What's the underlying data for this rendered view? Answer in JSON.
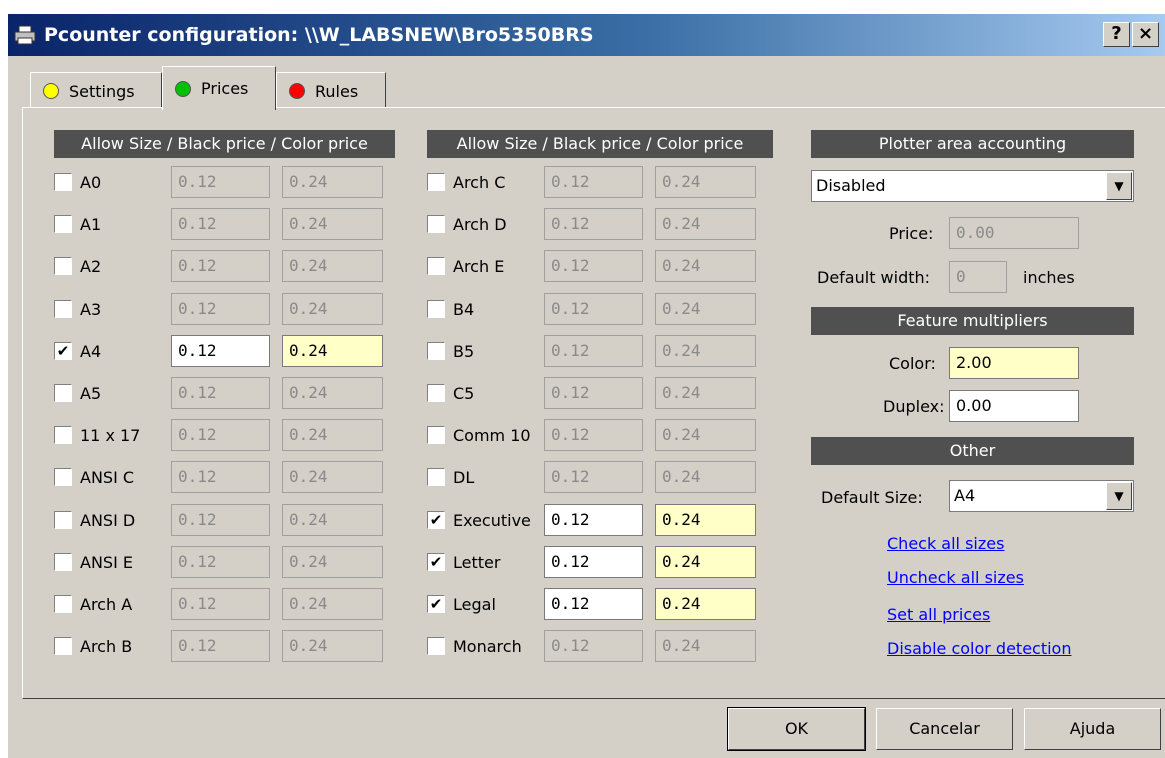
{
  "window": {
    "title": "Pcounter configuration: \\\\W_LABSNEW\\Bro5350BRS",
    "help_glyph": "?",
    "close_glyph": "×"
  },
  "tabs": [
    {
      "label": "Settings",
      "color": "#ffff00"
    },
    {
      "label": "Prices",
      "color": "#00c000"
    },
    {
      "label": "Rules",
      "color": "#ff0000"
    }
  ],
  "headers": {
    "col1": "Allow Size / Black price / Color price",
    "col2": "Allow Size / Black price / Color price",
    "plotter": "Plotter area accounting",
    "feature": "Feature multipliers",
    "other": "Other"
  },
  "sizes_left": [
    {
      "label": "A0",
      "checked": false,
      "black": "0.12",
      "color": "0.24"
    },
    {
      "label": "A1",
      "checked": false,
      "black": "0.12",
      "color": "0.24"
    },
    {
      "label": "A2",
      "checked": false,
      "black": "0.12",
      "color": "0.24"
    },
    {
      "label": "A3",
      "checked": false,
      "black": "0.12",
      "color": "0.24"
    },
    {
      "label": "A4",
      "checked": true,
      "black": "0.12",
      "color": "0.24"
    },
    {
      "label": "A5",
      "checked": false,
      "black": "0.12",
      "color": "0.24"
    },
    {
      "label": "11 x 17",
      "checked": false,
      "black": "0.12",
      "color": "0.24"
    },
    {
      "label": "ANSI C",
      "checked": false,
      "black": "0.12",
      "color": "0.24"
    },
    {
      "label": "ANSI D",
      "checked": false,
      "black": "0.12",
      "color": "0.24"
    },
    {
      "label": "ANSI E",
      "checked": false,
      "black": "0.12",
      "color": "0.24"
    },
    {
      "label": "Arch A",
      "checked": false,
      "black": "0.12",
      "color": "0.24"
    },
    {
      "label": "Arch B",
      "checked": false,
      "black": "0.12",
      "color": "0.24"
    }
  ],
  "sizes_right": [
    {
      "label": "Arch C",
      "checked": false,
      "black": "0.12",
      "color": "0.24"
    },
    {
      "label": "Arch D",
      "checked": false,
      "black": "0.12",
      "color": "0.24"
    },
    {
      "label": "Arch E",
      "checked": false,
      "black": "0.12",
      "color": "0.24"
    },
    {
      "label": "B4",
      "checked": false,
      "black": "0.12",
      "color": "0.24"
    },
    {
      "label": "B5",
      "checked": false,
      "black": "0.12",
      "color": "0.24"
    },
    {
      "label": "C5",
      "checked": false,
      "black": "0.12",
      "color": "0.24"
    },
    {
      "label": "Comm 10",
      "checked": false,
      "black": "0.12",
      "color": "0.24"
    },
    {
      "label": "DL",
      "checked": false,
      "black": "0.12",
      "color": "0.24"
    },
    {
      "label": "Executive",
      "checked": true,
      "black": "0.12",
      "color": "0.24"
    },
    {
      "label": "Letter",
      "checked": true,
      "black": "0.12",
      "color": "0.24"
    },
    {
      "label": "Legal",
      "checked": true,
      "black": "0.12",
      "color": "0.24"
    },
    {
      "label": "Monarch",
      "checked": false,
      "black": "0.12",
      "color": "0.24"
    }
  ],
  "plotter": {
    "mode": "Disabled",
    "price_label": "Price:",
    "price": "0.00",
    "width_label": "Default width:",
    "width": "0",
    "width_unit": "inches"
  },
  "feature": {
    "color_label": "Color:",
    "color": "2.00",
    "duplex_label": "Duplex:",
    "duplex": "0.00"
  },
  "other": {
    "default_size_label": "Default Size:",
    "default_size": "A4",
    "links": [
      "Check all sizes",
      "Uncheck all sizes",
      "Set all prices",
      "Disable color detection"
    ]
  },
  "buttons": {
    "ok": "OK",
    "cancel": "Cancelar",
    "help": "Ajuda"
  }
}
